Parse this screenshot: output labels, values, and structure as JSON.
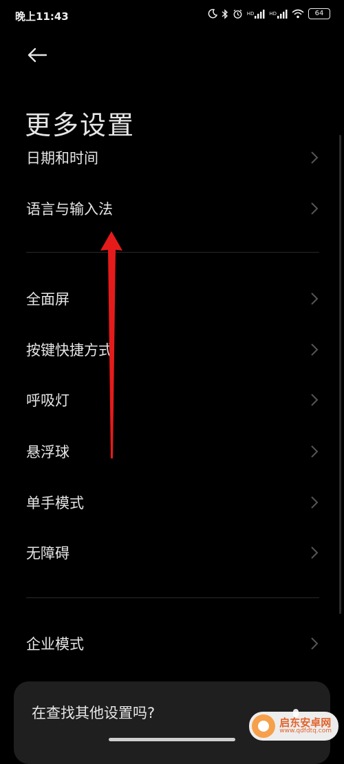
{
  "status_bar": {
    "time": "晚上11:43",
    "icons": [
      "moon-icon",
      "bluetooth-icon",
      "alarm-icon",
      "signal-hd-icon",
      "signal-hd-icon",
      "wifi-icon"
    ],
    "hd_label": "HD",
    "battery": "64"
  },
  "header": {
    "back_icon": "back-arrow-icon",
    "title": "更多设置"
  },
  "items": [
    {
      "label": "日期和时间"
    },
    {
      "label": "语言与输入法"
    },
    {
      "label": "全面屏"
    },
    {
      "label": "按键快捷方式"
    },
    {
      "label": "呼吸灯"
    },
    {
      "label": "悬浮球"
    },
    {
      "label": "单手模式"
    },
    {
      "label": "无障碍"
    },
    {
      "label": "企业模式"
    }
  ],
  "hint_card": {
    "text": "在查找其他设置吗?"
  },
  "watermark": {
    "title": "启东安卓网",
    "url": "www.qdfdtq.com"
  },
  "colors": {
    "background": "#000000",
    "text": "#e6e6e6",
    "annotation_arrow": "#e51b1b"
  }
}
